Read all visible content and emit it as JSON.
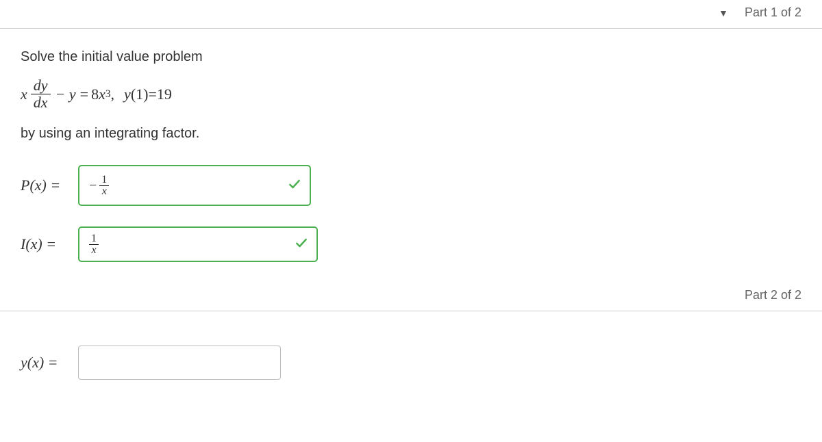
{
  "part1": {
    "label": "Part 1 of 2",
    "prompt_intro": "Solve the initial value problem",
    "equation": {
      "lhs_x": "x",
      "frac_num": "dy",
      "frac_den": "dx",
      "minus_y": "− y",
      "equals": " = ",
      "rhs_coeff": "8",
      "rhs_var": "x",
      "rhs_exp": "3",
      "comma": ",",
      "ic_y": "y",
      "ic_arg": "(1)",
      "ic_eq": " = ",
      "ic_val": "19"
    },
    "prompt_outro": "by using an integrating factor.",
    "answers": {
      "P_label": "P(x) =",
      "P_neg": "−",
      "P_num": "1",
      "P_den": "x",
      "I_label": "I(x) =",
      "I_num": "1",
      "I_den": "x"
    }
  },
  "part2": {
    "label": "Part 2 of 2",
    "answers": {
      "y_label": "y(x) ="
    }
  }
}
